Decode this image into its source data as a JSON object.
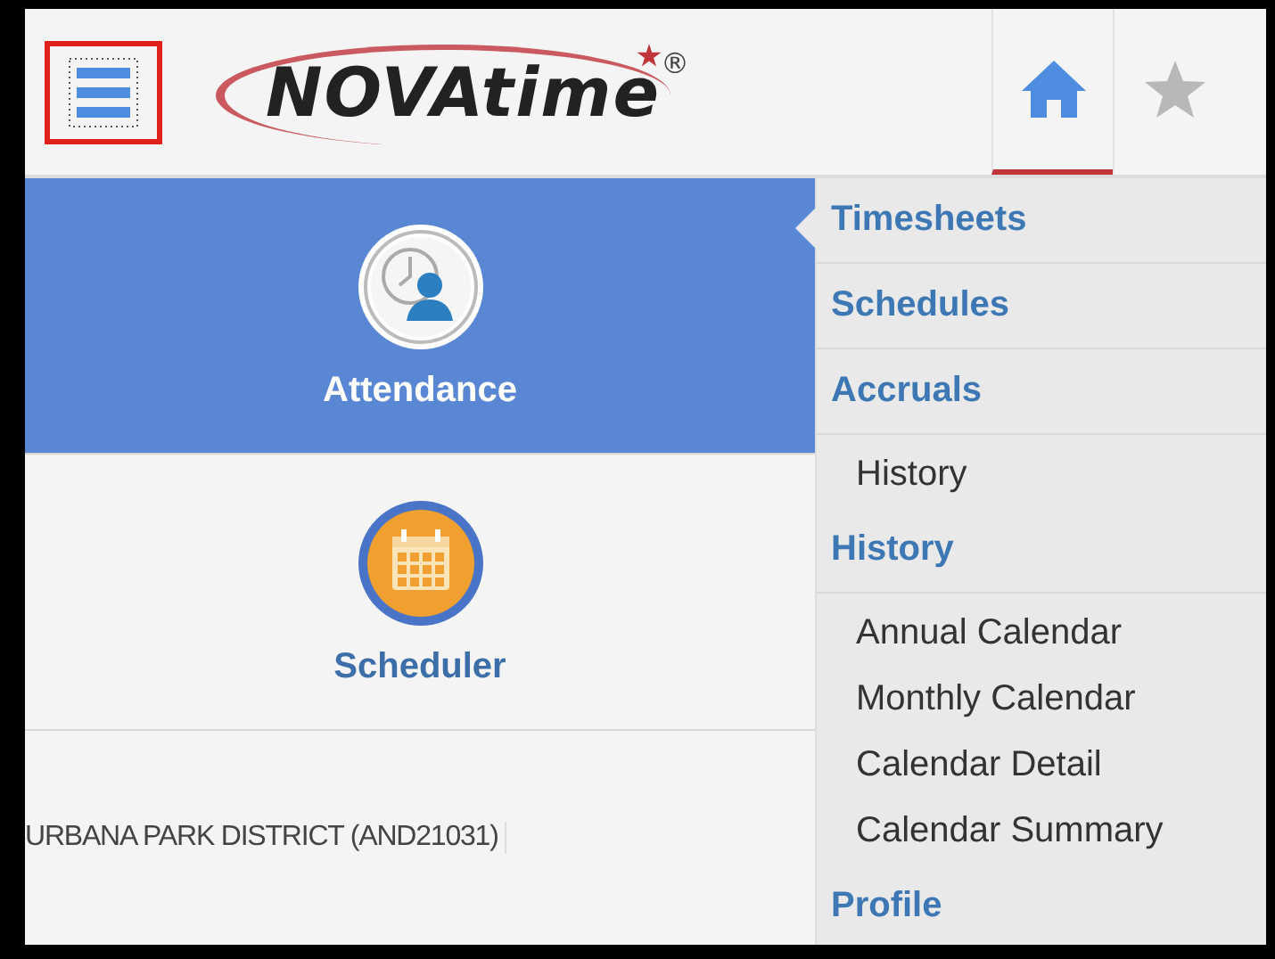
{
  "header": {
    "menu_button": {
      "highlighted": true
    },
    "logo": "NOVAtime$^{®}$",
    "tabs": [
      {
        "kind": "home",
        "selected": true
      },
      {
        "kind": "favorites",
        "selected": false
      }
    ]
  },
  "modules": [
    {
      "label": "Attendance",
      "kind": "attendance",
      "selected": true
    },
    {
      "label": "Scheduler",
      "kind": "scheduler",
      "selected": false
    }
  ],
  "company": "URBANA PARK DISTRICT (AND21031)",
  "menu": [
    {
      "label": "Timesheets",
      "kind": "heading"
    },
    {
      "label": "Schedules",
      "kind": "heading"
    },
    {
      "label": "Accruals",
      "kind": "heading"
    },
    {
      "label": "History",
      "kind": "item"
    },
    {
      "label": "History",
      "kind": "heading"
    },
    {
      "label": "Annual Calendar",
      "kind": "item"
    },
    {
      "label": "Monthly Calendar",
      "kind": "item"
    },
    {
      "label": "Calendar Detail",
      "kind": "item"
    },
    {
      "label": "Calendar Summary",
      "kind": "item"
    },
    {
      "label": "Profile",
      "kind": "heading"
    }
  ]
}
